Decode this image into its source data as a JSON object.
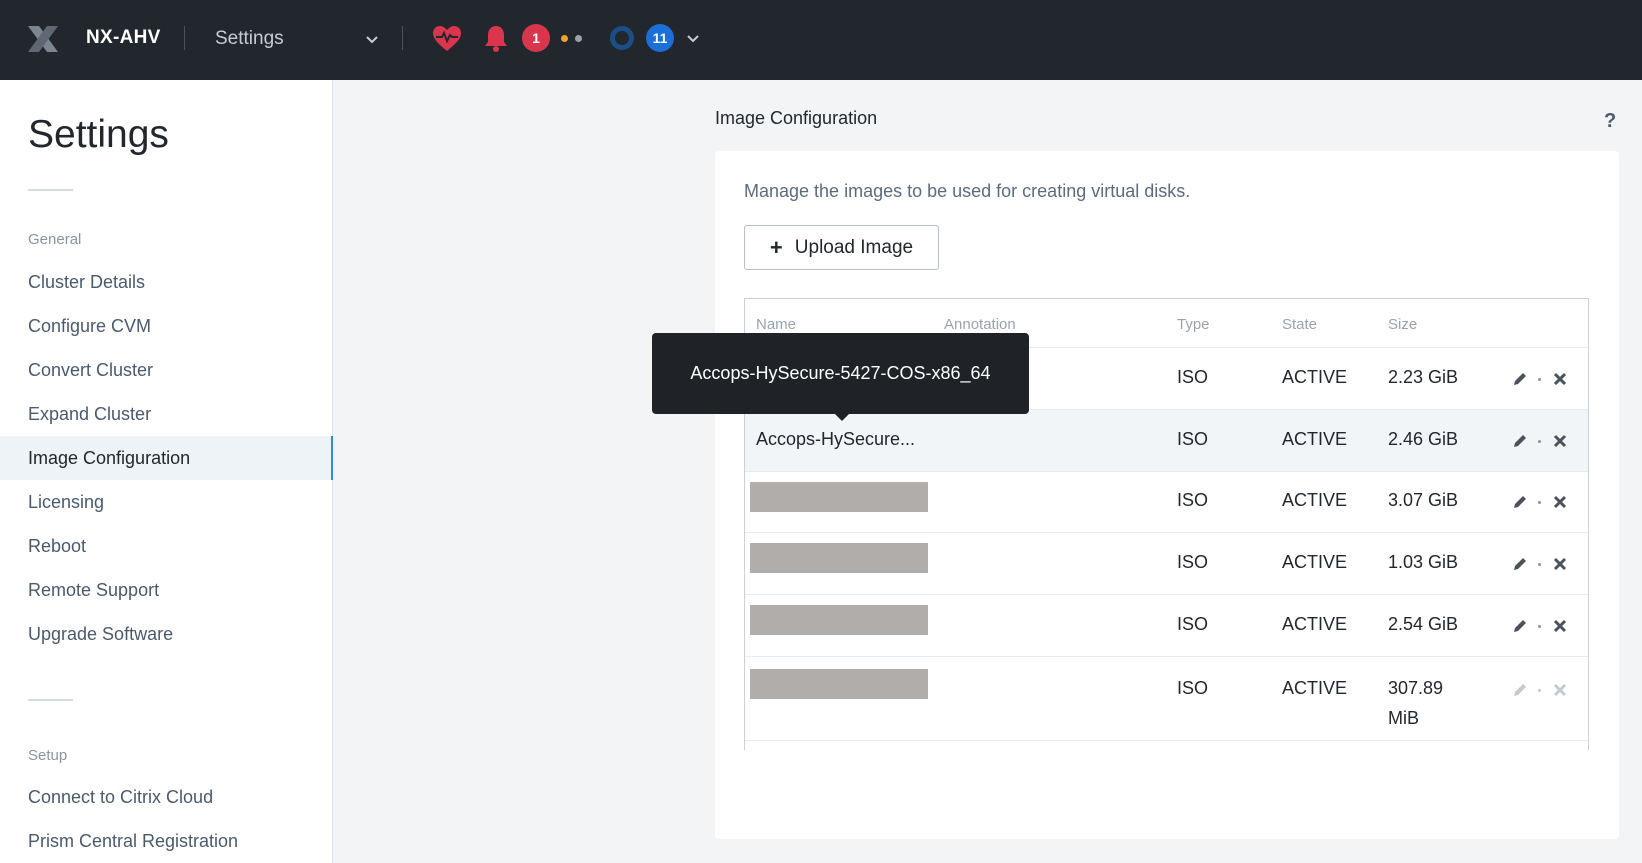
{
  "topbar": {
    "cluster_name": "NX-AHV",
    "menu_title": "Settings",
    "alerts_count": "1",
    "tasks_count": "11"
  },
  "sidebar": {
    "title": "Settings",
    "sections": [
      {
        "label": "General",
        "items": [
          {
            "label": "Cluster Details"
          },
          {
            "label": "Configure CVM"
          },
          {
            "label": "Convert Cluster"
          },
          {
            "label": "Expand Cluster"
          },
          {
            "label": "Image Configuration",
            "active": true
          },
          {
            "label": "Licensing"
          },
          {
            "label": "Reboot"
          },
          {
            "label": "Remote Support"
          },
          {
            "label": "Upgrade Software"
          }
        ]
      },
      {
        "label": "Setup",
        "items": [
          {
            "label": "Connect to Citrix Cloud"
          },
          {
            "label": "Prism Central Registration"
          }
        ]
      }
    ]
  },
  "main": {
    "title": "Image Configuration",
    "help": "?",
    "description": "Manage the images to be used for creating virtual disks.",
    "upload_label": "Upload Image",
    "table": {
      "headers": {
        "name": "Name",
        "annotation": "Annotation",
        "type": "Type",
        "state": "State",
        "size": "Size"
      },
      "rows": [
        {
          "name": "",
          "type": "ISO",
          "state": "ACTIVE",
          "size": "2.23 GiB"
        },
        {
          "name": "Accops-HySecure...",
          "type": "ISO",
          "state": "ACTIVE",
          "size": "2.46 GiB",
          "highlighted": true
        },
        {
          "name": "",
          "redacted": true,
          "type": "ISO",
          "state": "ACTIVE",
          "size": "3.07 GiB"
        },
        {
          "name": "",
          "redacted": true,
          "type": "ISO",
          "state": "ACTIVE",
          "size": "1.03 GiB"
        },
        {
          "name": "",
          "redacted": true,
          "type": "ISO",
          "state": "ACTIVE",
          "size": "2.54 GiB"
        },
        {
          "name": "",
          "redacted": true,
          "type": "ISO",
          "state": "ACTIVE",
          "size_line1": "307.89",
          "size_line2": "MiB",
          "actions_disabled": true
        }
      ]
    },
    "tooltip": "Accops-HySecure-5427-COS-x86_64"
  },
  "colors": {
    "topbar_bg": "#22272e",
    "accent": "#2d8cd6",
    "alert_red": "#d9364d",
    "task_blue": "#1b6fd6"
  },
  "icons": {
    "logo": "nutanix-x-logo",
    "health": "heart-pulse-icon",
    "alerts": "bell-icon",
    "edit": "pencil-icon",
    "delete": "close-icon"
  }
}
